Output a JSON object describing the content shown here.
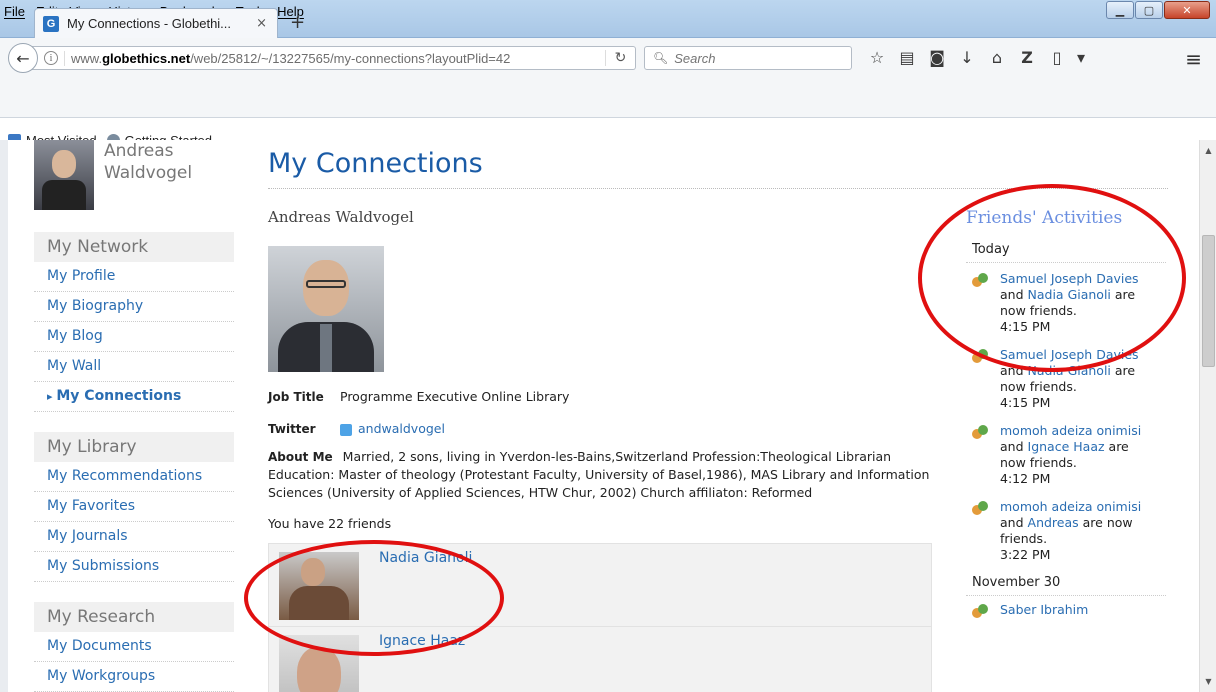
{
  "menu": [
    "File",
    "Edit",
    "View",
    "History",
    "Bookmarks",
    "Tools",
    "Help"
  ],
  "tab": {
    "title": "My Connections - Globethi...",
    "close": "×",
    "new": "+"
  },
  "url": {
    "prefix": "www.",
    "domain": "globethics.net",
    "path": "/web/25812/~/13227565/my-connections?layoutPlid=42"
  },
  "search": {
    "placeholder": "Search"
  },
  "bookmarks": [
    "Most Visited",
    "Getting Started"
  ],
  "sidebar": {
    "user": "Andreas Waldvogel",
    "network_header": "My Network",
    "network_items": [
      "My Profile",
      "My Biography",
      "My Blog",
      "My Wall",
      "My Connections"
    ],
    "library_header": "My Library",
    "library_items": [
      "My Recommendations",
      "My Favorites",
      "My Journals",
      "My Submissions"
    ],
    "research_header": "My Research",
    "research_items": [
      "My Documents",
      "My Workgroups"
    ]
  },
  "main": {
    "title": "My Connections",
    "profile_name": "Andreas Waldvogel",
    "job_label": "Job Title",
    "job_value": "Programme Executive Online Library",
    "twitter_label": "Twitter",
    "twitter_value": "andwaldvogel",
    "about_label": "About Me",
    "about_value": "Married, 2 sons, living in Yverdon-les-Bains,Switzerland Profession:Theological Librarian Education: Master of theology (Protestant Faculty, University of Basel,1986), MAS Library and Information Sciences (University of Applied Sciences, HTW Chur, 2002) Church affiliaton: Reformed",
    "friends_count": "You have 22 friends",
    "friends": [
      "Nadia Gianoli",
      "Ignace Haaz"
    ]
  },
  "activities": {
    "title": "Friends' Activities",
    "today": "Today",
    "items": [
      {
        "a": "Samuel Joseph Davies",
        "b": "Nadia Gianoli",
        "time": "4:15 PM"
      },
      {
        "a": "Samuel Joseph Davies",
        "b": "Nadia Gianoli",
        "time": "4:15 PM"
      },
      {
        "a": "momoh adeiza onimisi",
        "b": "Ignace Haaz",
        "time": "4:12 PM"
      },
      {
        "a": "momoh adeiza onimisi",
        "b": "Andreas",
        "time": "3:22 PM"
      }
    ],
    "and": "and",
    "are_now_friends": "are now friends.",
    "nov": "November 30",
    "next_user": "Saber Ibrahim"
  },
  "colors": {
    "link": "#2a6db2",
    "title": "#1a5ba6",
    "annotation": "#e01010"
  }
}
